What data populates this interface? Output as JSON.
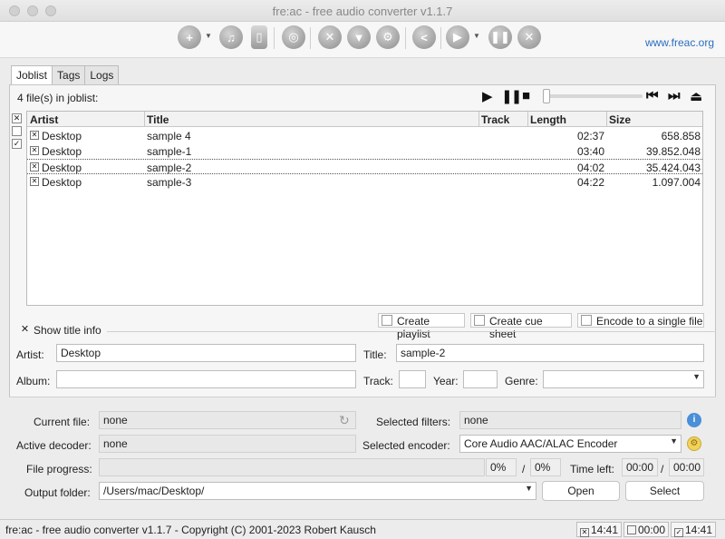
{
  "window": {
    "title": "fre:ac - free audio converter v1.1.7",
    "link": "www.freac.org"
  },
  "tabs": [
    {
      "label": "Joblist"
    },
    {
      "label": "Tags"
    },
    {
      "label": "Logs"
    }
  ],
  "joblist": {
    "count_text": "4 file(s) in joblist:",
    "columns": {
      "artist": "Artist",
      "title": "Title",
      "track": "Track",
      "length": "Length",
      "size": "Size"
    },
    "rows": [
      {
        "artist": "Desktop",
        "title": "sample 4",
        "track": "",
        "length": "02:37",
        "size": "658.858",
        "checked": true
      },
      {
        "artist": "Desktop",
        "title": "sample-1",
        "track": "",
        "length": "03:40",
        "size": "39.852.048",
        "checked": true
      },
      {
        "artist": "Desktop",
        "title": "sample-2",
        "track": "",
        "length": "04:02",
        "size": "35.424.043",
        "checked": true
      },
      {
        "artist": "Desktop",
        "title": "sample-3",
        "track": "",
        "length": "04:22",
        "size": "1.097.004",
        "checked": true
      }
    ],
    "options": {
      "create_playlist": "Create playlist",
      "create_cue_sheet": "Create cue sheet",
      "encode_single": "Encode to a single file"
    }
  },
  "title_info": {
    "label": "Show title info",
    "artist_label": "Artist:",
    "artist_value": "Desktop",
    "title_label": "Title:",
    "title_value": "sample-2",
    "album_label": "Album:",
    "album_value": "",
    "track_label": "Track:",
    "track_value": "",
    "year_label": "Year:",
    "year_value": "",
    "genre_label": "Genre:",
    "genre_value": ""
  },
  "status": {
    "current_file_label": "Current file:",
    "current_file": "none",
    "selected_filters_label": "Selected filters:",
    "selected_filters": "none",
    "active_decoder_label": "Active decoder:",
    "active_decoder": "none",
    "selected_encoder_label": "Selected encoder:",
    "selected_encoder": "Core Audio AAC/ALAC Encoder",
    "file_progress_label": "File progress:",
    "file_progress_pct": "0%",
    "total_progress_pct": "0%",
    "progress_sep": "/",
    "time_left_label": "Time left:",
    "time_left_file": "00:00",
    "time_sep": "/",
    "time_left_total": "00:00",
    "output_folder_label": "Output folder:",
    "output_folder": "/Users/mac/Desktop/",
    "open_label": "Open",
    "select_label": "Select"
  },
  "statusbar": {
    "text": "fre:ac - free audio converter v1.1.7 - Copyright (C) 2001-2023 Robert Kausch",
    "time1": "14:41",
    "time2": "00:00",
    "time3": "14:41"
  }
}
